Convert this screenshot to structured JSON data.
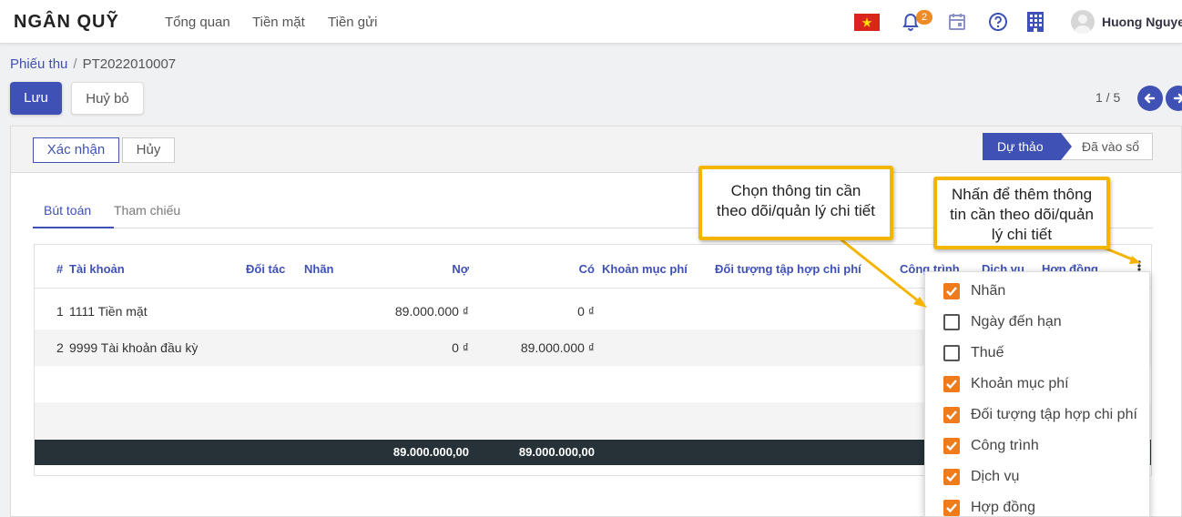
{
  "app": {
    "brand": "NGÂN QUỸ",
    "user_name": "Huong Nguyen"
  },
  "nav": {
    "items": [
      "Tổng quan",
      "Tiền mặt",
      "Tiền gửi"
    ],
    "notification_count": "2"
  },
  "icons": [
    "flag-vietnam-icon",
    "bell-icon",
    "calendar-icon",
    "help-icon",
    "building-icon",
    "user-avatar-icon",
    "arrow-left-icon",
    "arrow-right-icon",
    "check-icon",
    "column-options-icon"
  ],
  "breadcrumb": {
    "parent": "Phiếu thu",
    "separator": "/",
    "current": "PT2022010007"
  },
  "actions": {
    "save": "Lưu",
    "discard": "Huỷ bỏ"
  },
  "pager": {
    "text": "1 / 5"
  },
  "status_buttons": {
    "confirm": "Xác nhận",
    "cancel": "Hủy"
  },
  "stages": {
    "active": "Dự thảo",
    "next": "Đã vào sổ"
  },
  "tabs": [
    "Bút toán",
    "Tham chiếu"
  ],
  "table": {
    "headers": {
      "num": "#",
      "account": "Tài khoản",
      "partner": "Đối tác",
      "label": "Nhãn",
      "debit": "Nợ",
      "credit": "Có",
      "expense_item": "Khoản mục phí",
      "cost_object": "Đối tượng tập hợp chi phí",
      "project": "Công trình",
      "service": "Dịch vụ",
      "contract": "Hợp đồng"
    },
    "rows": [
      {
        "num": "1",
        "account": "1111 Tiền mặt",
        "debit": "89.000.000 ₫",
        "credit": "0 ₫"
      },
      {
        "num": "2",
        "account": "9999 Tài khoản đầu kỳ",
        "debit": "0 ₫",
        "credit": "89.000.000 ₫"
      }
    ],
    "totals": {
      "debit": "89.000.000,00",
      "credit": "89.000.000,00"
    }
  },
  "column_options": [
    {
      "label": "Nhãn",
      "checked": true
    },
    {
      "label": "Ngày đến hạn",
      "checked": false
    },
    {
      "label": "Thuế",
      "checked": false
    },
    {
      "label": "Khoản mục phí",
      "checked": true
    },
    {
      "label": "Đối tượng tập hợp chi phí",
      "checked": true
    },
    {
      "label": "Công trình",
      "checked": true
    },
    {
      "label": "Dịch vụ",
      "checked": true
    },
    {
      "label": "Hợp đồng",
      "checked": true
    }
  ],
  "callouts": {
    "choose_line1": "Chọn thông tin cần",
    "choose_line2": "theo dõi/quản lý chi tiết",
    "click_line1": "Nhấn để thêm thông",
    "click_line2": "tin cần theo dõi/quản",
    "click_line3": "lý chi tiết"
  },
  "colors": {
    "primary": "#3f51b5",
    "checkbox": "#f07b1a",
    "callout_border": "#f5b400",
    "total_bar": "#263238"
  }
}
